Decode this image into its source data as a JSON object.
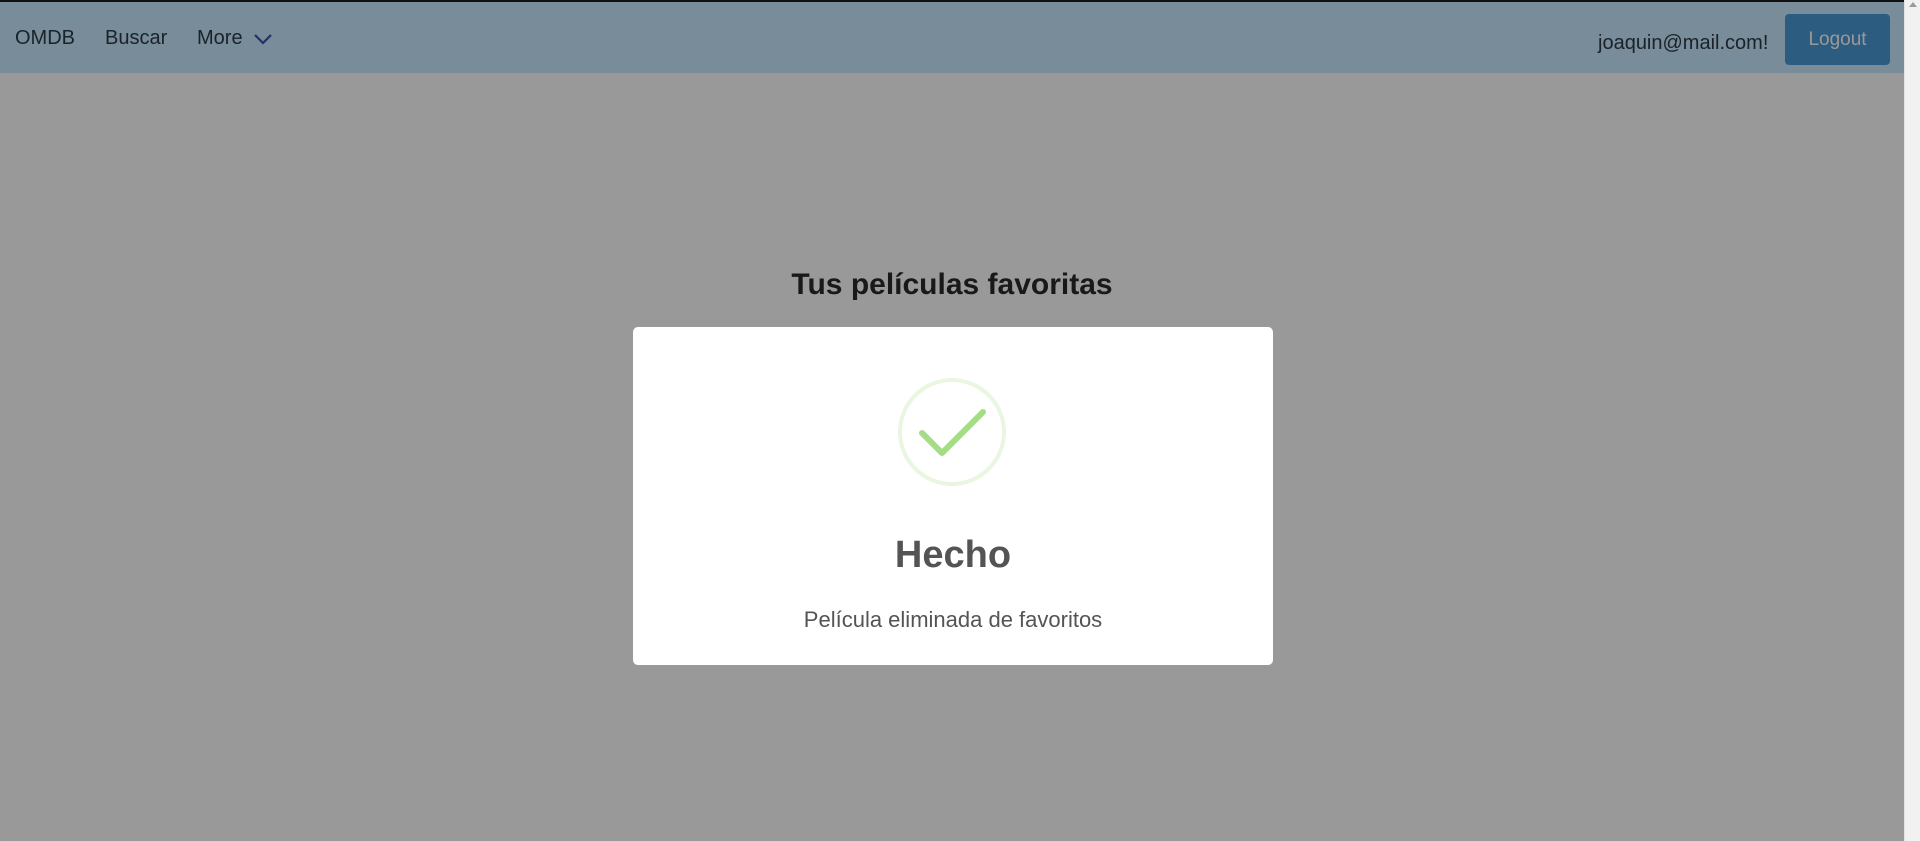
{
  "navbar": {
    "brand": "OMDB",
    "search_link": "Buscar",
    "more_label": "More",
    "more_icon": "chevron-down-icon",
    "user_email": "joaquin@mail.com!",
    "logout_label": "Logout"
  },
  "page": {
    "title": "Tus películas favoritas"
  },
  "modal": {
    "icon": "success-check-icon",
    "title": "Hecho",
    "message": "Película eliminada de favoritos"
  },
  "colors": {
    "navbar_bg": "#c9e9ff",
    "logout_bg": "#4a9ad6",
    "success_green": "#a5dc86",
    "overlay": "rgba(0,0,0,0.4)"
  }
}
